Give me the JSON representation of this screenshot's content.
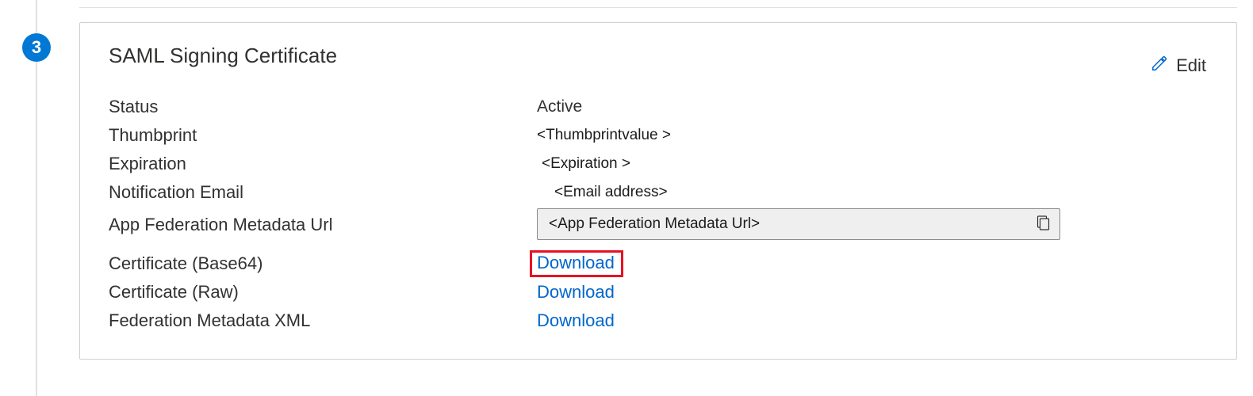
{
  "step": {
    "number": "3"
  },
  "card": {
    "title": "SAML Signing Certificate",
    "edit_label": "Edit"
  },
  "fields": {
    "status": {
      "label": "Status",
      "value": "Active"
    },
    "thumbprint": {
      "label": "Thumbprint",
      "value": "<Thumbprintvalue >"
    },
    "expiration": {
      "label": "Expiration",
      "value": "<Expiration >"
    },
    "notification_email": {
      "label": "Notification Email",
      "value": "<Email address>"
    },
    "federation_url": {
      "label": "App Federation Metadata Url",
      "value": "<App Federation Metadata Url>"
    },
    "cert_base64": {
      "label": "Certificate (Base64)",
      "link": "Download"
    },
    "cert_raw": {
      "label": "Certificate (Raw)",
      "link": "Download"
    },
    "fed_metadata_xml": {
      "label": "Federation Metadata XML",
      "link": "Download"
    }
  }
}
